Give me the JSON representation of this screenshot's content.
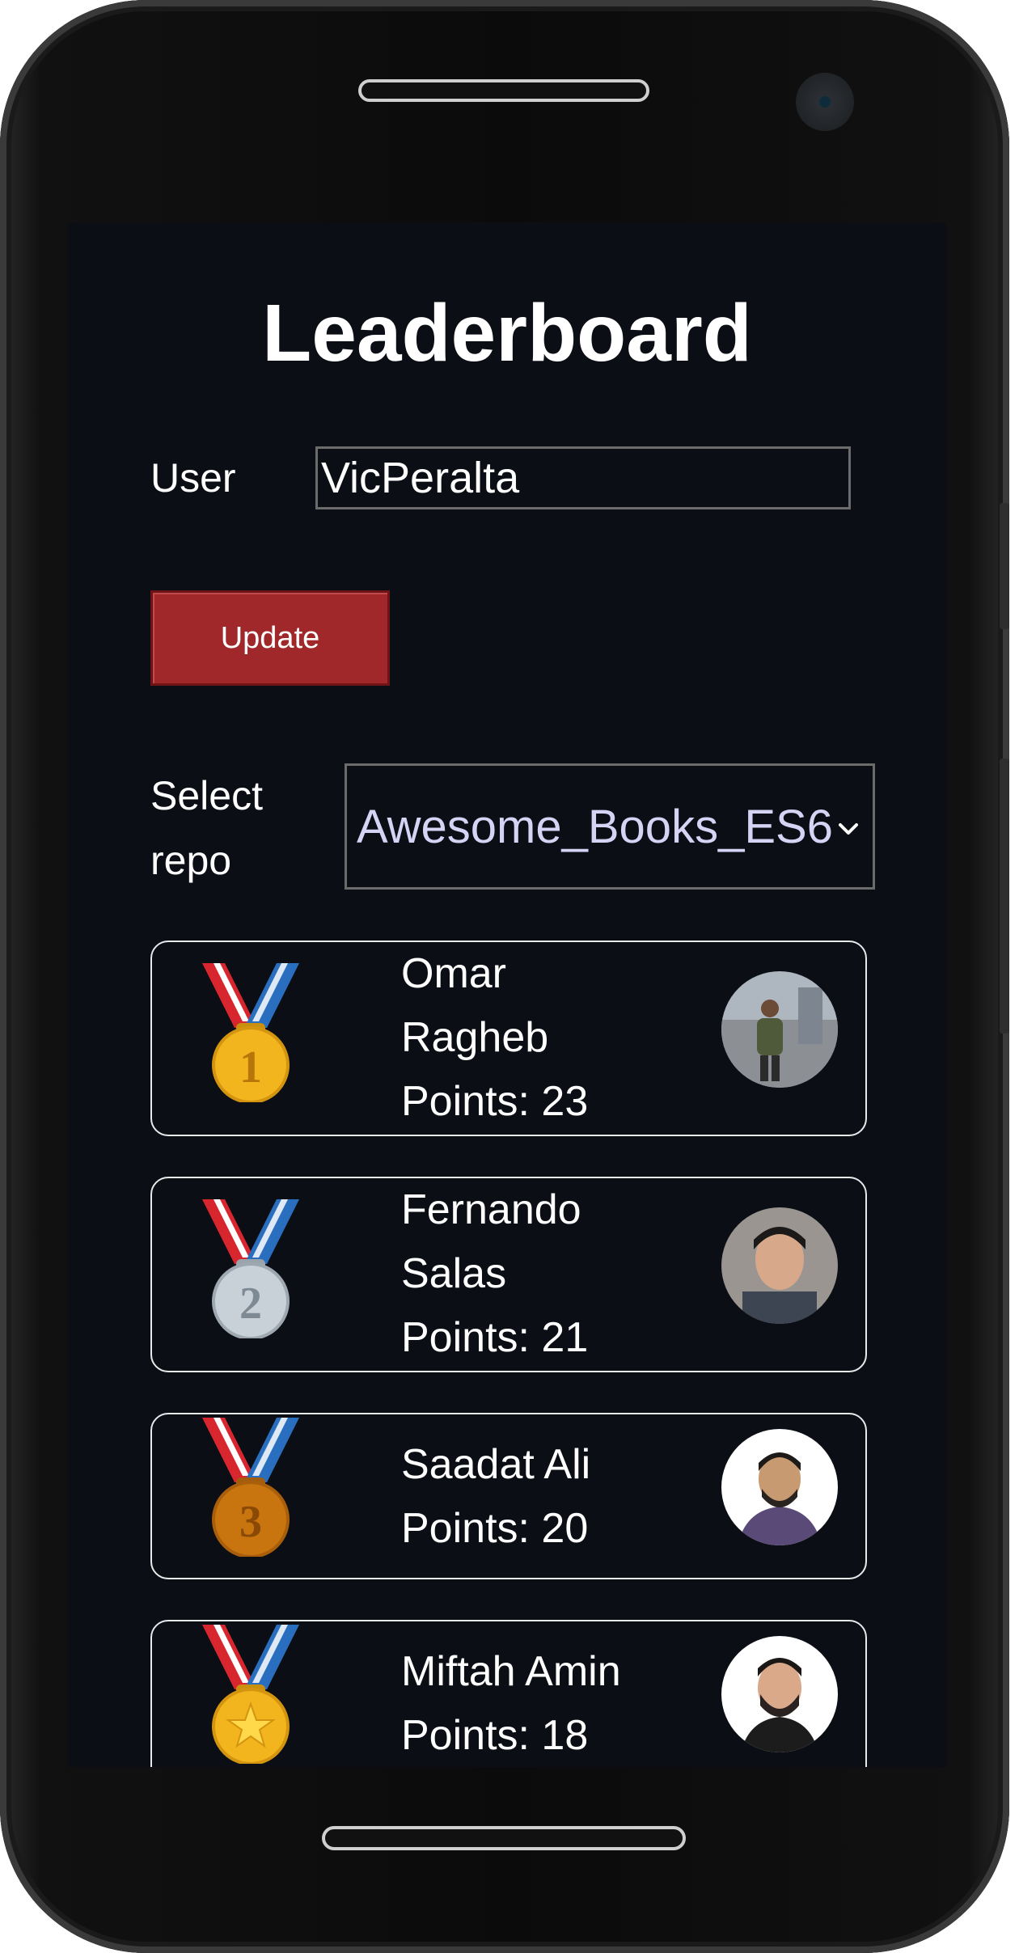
{
  "header": {
    "title": "Leaderboard"
  },
  "user_form": {
    "label": "User",
    "value": "VicPeralta",
    "button": "Update"
  },
  "repo": {
    "label_line1": "Select",
    "label_line2": "repo",
    "selected": "Awesome_Books_ES6"
  },
  "leaderboard": [
    {
      "name_line1": "Omar",
      "name_line2": "Ragheb",
      "points": "Points: 23",
      "medal": "gold-medal-1"
    },
    {
      "name_line1": "Fernando",
      "name_line2": "Salas",
      "points": "Points: 21",
      "medal": "silver-medal-2"
    },
    {
      "name_line1": "Saadat Ali",
      "points": "Points: 20",
      "medal": "bronze-medal-3"
    },
    {
      "name_line1": "Miftah Amin",
      "points": "Points: 18",
      "medal": "star-medal"
    }
  ],
  "colors": {
    "screen_bg": "#0b0e15",
    "button_bg": "#a0282a",
    "select_text": "#d6d3f5",
    "gold": "#f2b51e",
    "silver": "#b9c2ca",
    "bronze": "#c8740f"
  }
}
